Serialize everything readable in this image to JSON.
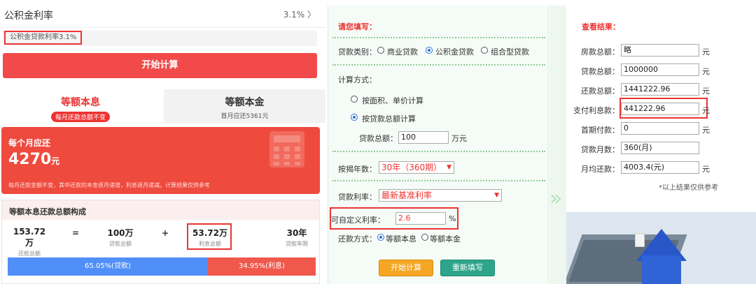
{
  "left": {
    "rate_title": "公积金利率",
    "rate_value": "3.1% 〉",
    "rate_note": "公积金贷款利率3.1%",
    "start_button": "开始计算",
    "tabs": [
      {
        "label": "等额本息",
        "sub": "每月还款总额不变"
      },
      {
        "label": "等额本金",
        "sub": "首月应还5361元"
      }
    ],
    "monthly": {
      "label": "每个月应还",
      "amount": "4270",
      "unit": "元",
      "note": "每月还款金额不变，其中还款的本金逐月递增，利息逐月递减。计算结果仅供参考"
    },
    "composition": {
      "title": "等额本息还款总额构成",
      "items": [
        {
          "value": "153.72万",
          "label": "还款总额"
        },
        {
          "value": "100万",
          "label": "贷款总额"
        },
        {
          "value": "53.72万",
          "label": "利息总额"
        },
        {
          "value": "30年",
          "label": "贷款年限"
        }
      ],
      "ops": [
        "=",
        "+"
      ],
      "bar_principal": "65.05%(贷款)",
      "bar_interest": "34.95%(利息)",
      "principal_share": 0.6505
    }
  },
  "middle": {
    "title": "请您填写：",
    "loan_type_label": "贷款类别：",
    "loan_types": [
      "商业贷款",
      "公积金贷款",
      "组合型贷款"
    ],
    "calc_method_label": "计算方式：",
    "calc_methods": [
      "按面积、单价计算",
      "按贷款总额计算"
    ],
    "loan_total_label": "贷款总额：",
    "loan_total_value": "100",
    "loan_total_unit": "万元",
    "years_label": "按揭年数：",
    "years_value": "30年（360期）",
    "rate_label": "贷款利率：",
    "rate_value": "最新基准利率",
    "custom_rate_label": "可自定义利率：",
    "custom_rate_value": "2.6",
    "custom_rate_unit": "%",
    "repay_label": "还款方式：",
    "repay_methods": [
      "等额本息",
      "等额本金"
    ],
    "start_button": "开始计算",
    "reset_button": "重新填写"
  },
  "right": {
    "title": "查看结果：",
    "rows": [
      {
        "label": "房款总额：",
        "value": "略",
        "unit": "元"
      },
      {
        "label": "贷款总额：",
        "value": "1000000",
        "unit": "元"
      },
      {
        "label": "还款总额：",
        "value": "1441222.96",
        "unit": "元"
      },
      {
        "label": "支付利息款：",
        "value": "441222.96",
        "unit": "元"
      },
      {
        "label": "首期付款：",
        "value": "0",
        "unit": "元"
      },
      {
        "label": "贷款月数：",
        "value": "360(月)",
        "unit": ""
      },
      {
        "label": "月均还款：",
        "value": "4003.4(元)",
        "unit": "元"
      }
    ],
    "note": "*以上结果仅供参考"
  },
  "colors": {
    "accent_red": "#f24a4a",
    "blue_bar": "#4f8ff7",
    "green_dots": "#8ccf9a",
    "orange_button": "#f5a623",
    "teal_button": "#2ea58a"
  }
}
